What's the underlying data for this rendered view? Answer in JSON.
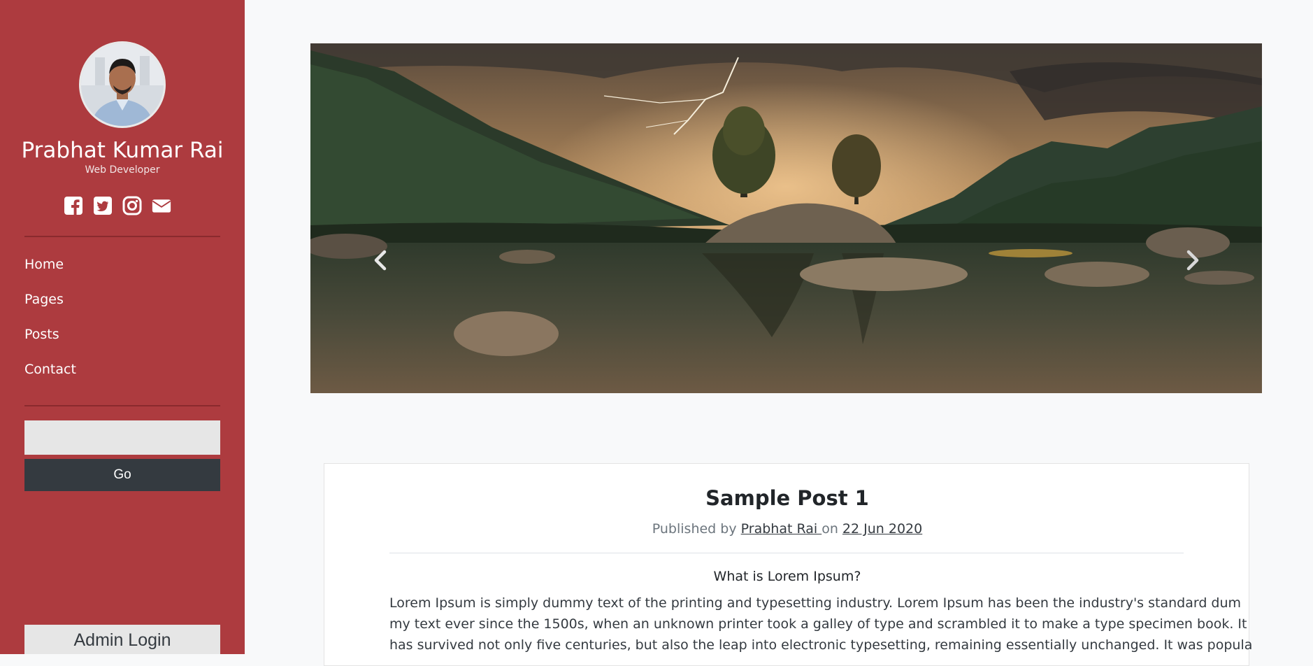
{
  "profile": {
    "name": "Prabhat Kumar Rai",
    "role": "Web Developer",
    "social_icons": [
      "facebook-icon",
      "twitter-icon",
      "instagram-icon",
      "envelope-icon"
    ]
  },
  "nav": {
    "items": [
      {
        "label": "Home"
      },
      {
        "label": "Pages"
      },
      {
        "label": "Posts"
      },
      {
        "label": "Contact"
      }
    ]
  },
  "search": {
    "value": "",
    "button_label": "Go"
  },
  "admin": {
    "label": "Admin Login"
  },
  "carousel": {
    "prev_icon": "chevron-left-icon",
    "next_icon": "chevron-right-icon"
  },
  "post": {
    "title": "Sample Post 1",
    "published_by": "Published by",
    "author": "Prabhat Rai ",
    "on": "on",
    "date": "22 Jun 2020",
    "subheading": "What is Lorem Ipsum?",
    "body_lines": [
      "Lorem Ipsum is simply dummy text of the printing and typesetting industry. Lorem Ipsum has been the industry's standard dum",
      "my text ever since the 1500s, when an unknown printer took a galley of type and scrambled it to make a type specimen book. It",
      "has survived not only five centuries, but also the leap into electronic typesetting, remaining essentially unchanged. It was popula"
    ]
  },
  "colors": {
    "sidebar_bg": "#ad3b3f",
    "page_bg": "#f8f9fa",
    "go_button_bg": "#343a40",
    "input_bg": "#e6e6e6"
  }
}
